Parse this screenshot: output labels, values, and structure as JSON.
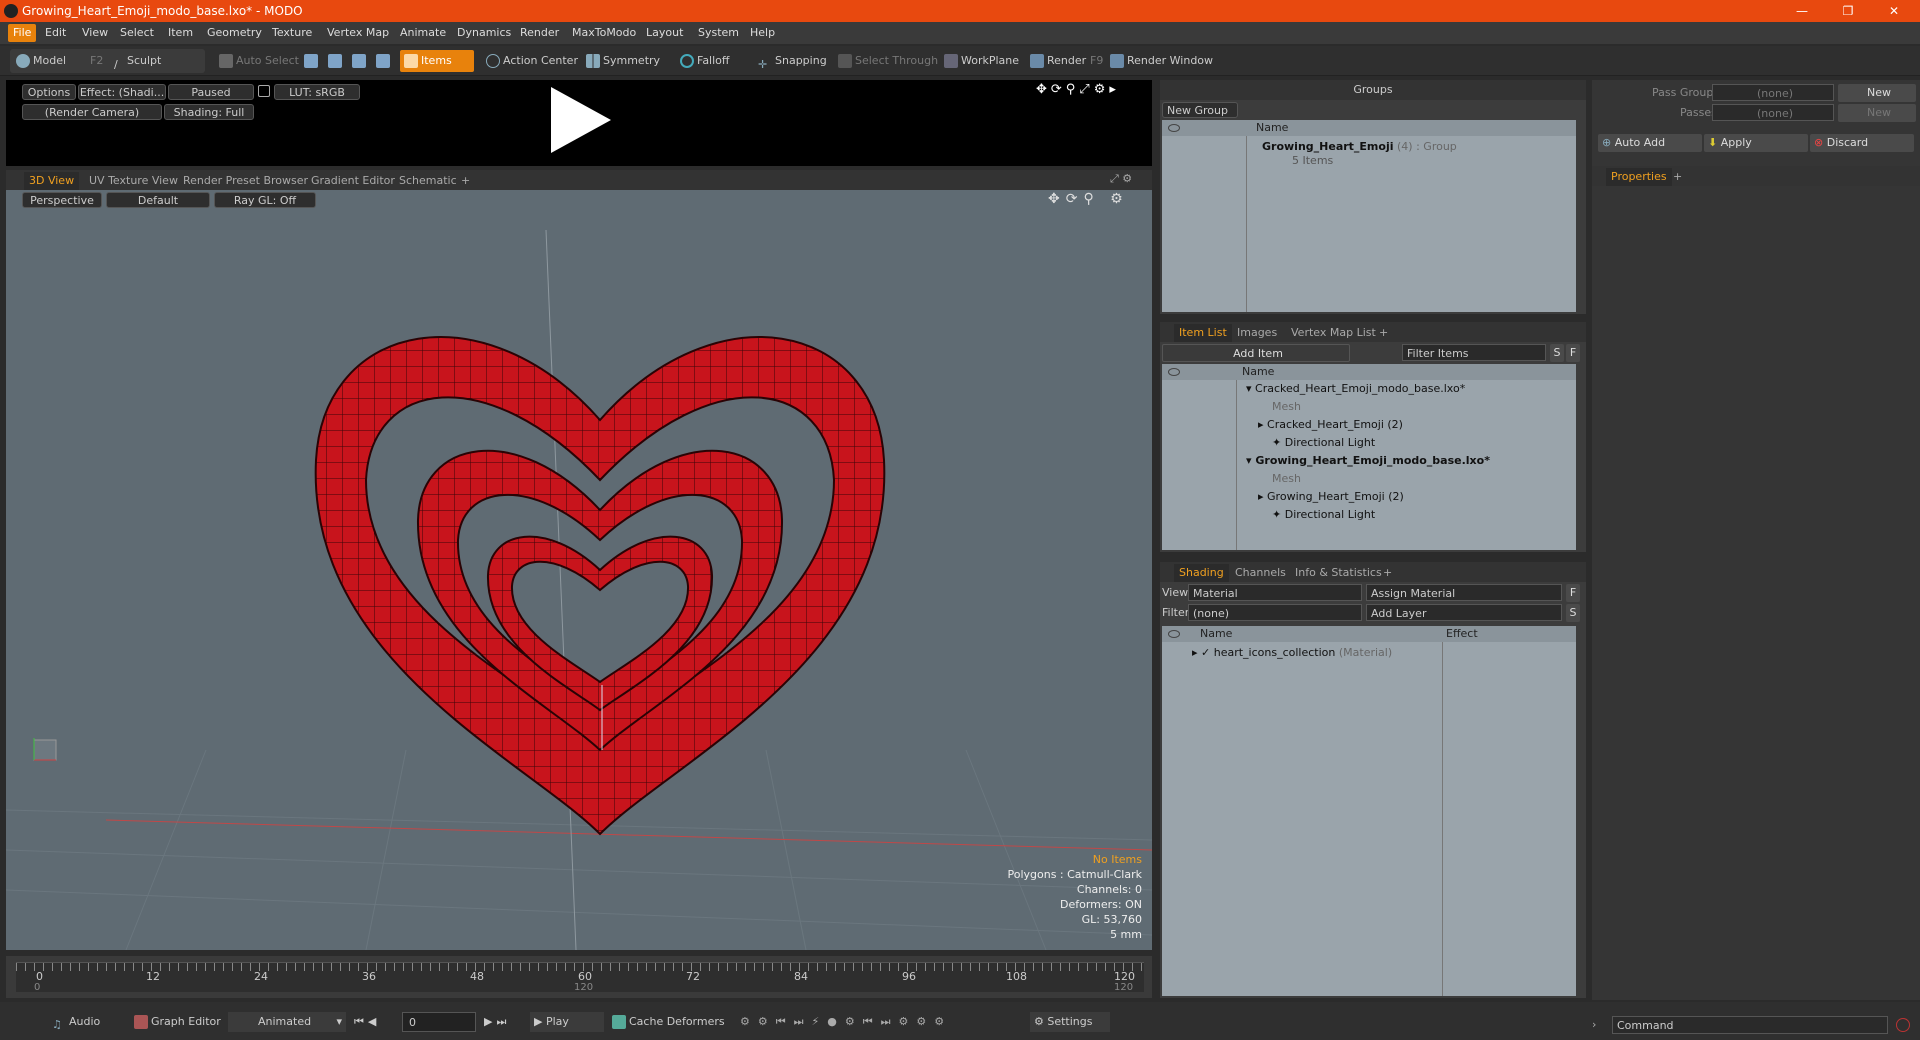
{
  "window": {
    "title": "Growing_Heart_Emoji_modo_base.lxo* - MODO",
    "minimize": "—",
    "restore": "❐",
    "close": "✕"
  },
  "menu": [
    "File",
    "Edit",
    "View",
    "Select",
    "Item",
    "Geometry",
    "Texture",
    "Vertex Map",
    "Animate",
    "Dynamics",
    "Render",
    "MaxToModo",
    "Layout",
    "System",
    "Help"
  ],
  "toolbar": {
    "model": "Model",
    "model_key": "F2",
    "sculpt": "Sculpt",
    "auto_select": "Auto Select",
    "items": "Items",
    "action_center": "Action Center",
    "symmetry": "Symmetry",
    "falloff": "Falloff",
    "snapping": "Snapping",
    "select_through": "Select Through",
    "workplane": "WorkPlane",
    "render": "Render",
    "render_key": "F9",
    "render_window": "Render Window"
  },
  "preview": {
    "options": "Options",
    "effect": "Effect: (Shadi...",
    "paused": "Paused",
    "lut": "LUT: sRGB",
    "camera": "(Render Camera)",
    "shading": "Shading: Full"
  },
  "view_tabs": [
    "3D View",
    "UV Texture View",
    "Render Preset Browser",
    "Gradient Editor",
    "Schematic",
    "+"
  ],
  "viewport": {
    "perspective": "Perspective",
    "default": "Default",
    "raygl": "Ray GL: Off"
  },
  "stats": {
    "items": "No Items",
    "polygons": "Polygons : Catmull-Clark",
    "channels": "Channels: 0",
    "deformers": "Deformers: ON",
    "gl": "GL: 53,760",
    "unit": "5 mm"
  },
  "timeline": {
    "ticks": [
      "0",
      "12",
      "24",
      "36",
      "48",
      "60",
      "72",
      "84",
      "96",
      "108",
      "120"
    ],
    "start": "0",
    "mid": "120",
    "end": "120"
  },
  "bottom": {
    "audio": "Audio",
    "graph_editor": "Graph Editor",
    "animated": "Animated",
    "frame": "0",
    "play": "Play",
    "cache": "Cache Deformers",
    "settings": "Settings"
  },
  "groups": {
    "title": "Groups",
    "new_group": "New Group",
    "col_name": "Name",
    "row_name": "Growing_Heart_Emoji",
    "row_count": "(4)",
    "row_type": ": Group",
    "row_sub": "5 Items"
  },
  "passes": {
    "pass_groups": "Pass Groups",
    "passes": "Passes",
    "none1": "(none)",
    "none2": "(none)",
    "new1": "New",
    "new2": "New",
    "auto_add": "Auto Add",
    "apply": "Apply",
    "discard": "Discard",
    "properties": "Properties",
    "plus": "+"
  },
  "itemlist": {
    "tabs": [
      "Item List",
      "Images",
      "Vertex Map List",
      "+"
    ],
    "add_item": "Add Item",
    "filter": "Filter Items",
    "s": "S",
    "f": "F",
    "col_name": "Name",
    "rows": [
      {
        "label": "Cracked_Heart_Emoji_modo_base.lxo*",
        "indent": 0,
        "muted": false,
        "bold": false
      },
      {
        "label": "Mesh",
        "indent": 1,
        "muted": true,
        "bold": false
      },
      {
        "label": "Cracked_Heart_Emoji (2)",
        "indent": 1,
        "muted": false,
        "bold": false
      },
      {
        "label": "Directional Light",
        "indent": 1,
        "muted": false,
        "bold": false
      },
      {
        "label": "Growing_Heart_Emoji_modo_base.lxo*",
        "indent": 0,
        "muted": false,
        "bold": true
      },
      {
        "label": "Mesh",
        "indent": 1,
        "muted": true,
        "bold": false
      },
      {
        "label": "Growing_Heart_Emoji (2)",
        "indent": 1,
        "muted": false,
        "bold": false
      },
      {
        "label": "Directional Light",
        "indent": 1,
        "muted": false,
        "bold": false
      }
    ]
  },
  "shading": {
    "tabs": [
      "Shading",
      "Channels",
      "Info & Statistics",
      "+"
    ],
    "view_label": "View",
    "view_value": "Material",
    "assign": "Assign Material",
    "filter_label": "Filter",
    "filter_value": "(none)",
    "add_layer": "Add Layer",
    "f": "F",
    "s": "S",
    "col_name": "Name",
    "col_effect": "Effect",
    "row": "heart_icons_collection",
    "row_type": "(Material)"
  },
  "command": {
    "placeholder": "Command"
  },
  "colors": {
    "accent": "#e8820c",
    "title": "#e8490f",
    "heart": "#c8141c"
  }
}
